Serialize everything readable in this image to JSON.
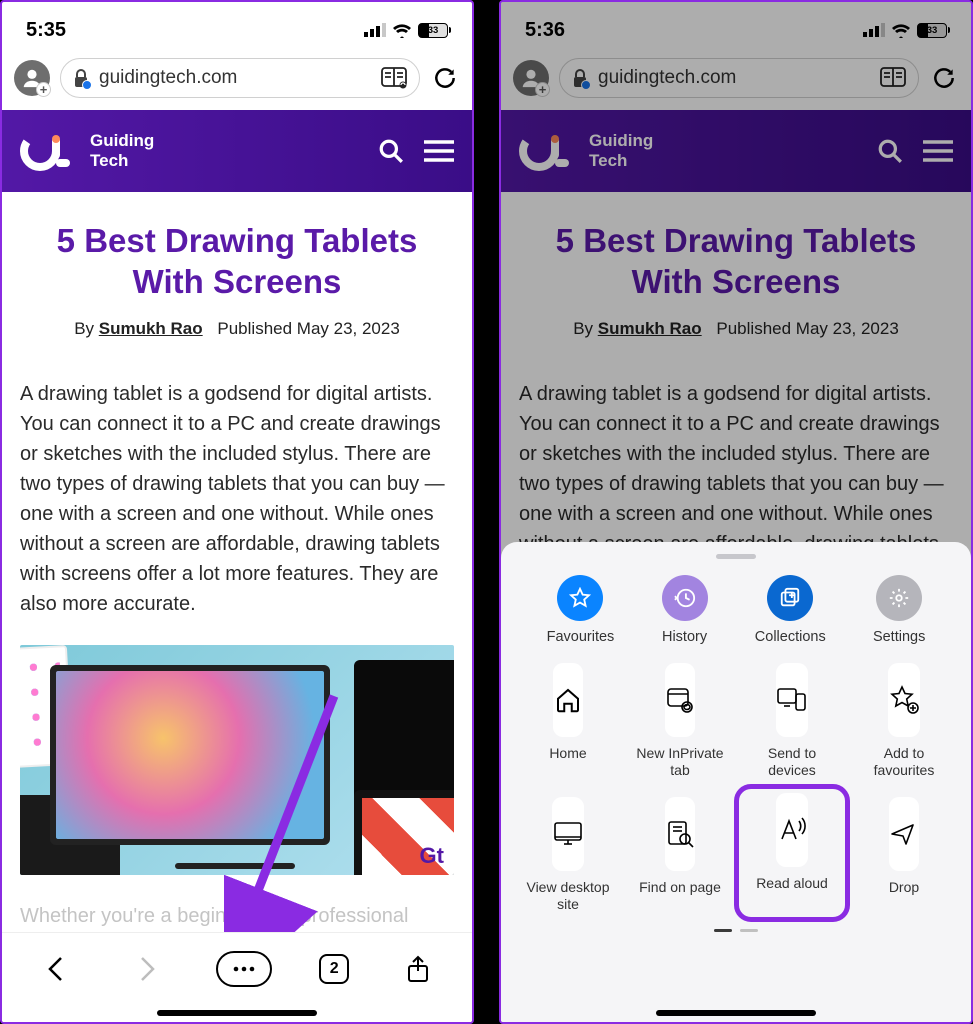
{
  "left": {
    "status": {
      "time": "5:35",
      "battery": "33"
    },
    "browser": {
      "url": "guidingtech.com"
    },
    "site": {
      "name_line1": "Guiding",
      "name_line2": "Tech"
    },
    "article": {
      "title": "5 Best Drawing Tablets With Screens",
      "by_prefix": "By ",
      "author": "Sumukh Rao",
      "published": "Published May 23, 2023",
      "para1": "A drawing tablet is a godsend for digital artists. You can connect it to a PC and create drawings or sketches with the included stylus. There are two types of drawing tablets that you can buy — one with a screen and one without. While ones without a screen are affordable, drawing tablets with screens offer a lot more features. They are also more accurate.",
      "para2": "Whether you're a beginner or a professional looking for a tablet for digital art, consider getting",
      "hero_watermark": "Gt"
    },
    "toolbar": {
      "tab_count": "2"
    }
  },
  "right": {
    "status": {
      "time": "5:36",
      "battery": "33"
    },
    "browser": {
      "url": "guidingtech.com"
    },
    "site": {
      "name_line1": "Guiding",
      "name_line2": "Tech"
    },
    "article": {
      "title": "5 Best Drawing Tablets With Screens",
      "by_prefix": "By ",
      "author": "Sumukh Rao",
      "published": "Published May 23, 2023",
      "para1": "A drawing tablet is a godsend for digital artists. You can connect it to a PC and create drawings or sketches with the included stylus. There are two types of drawing tablets that you can buy — one with a screen and one without. While ones without a screen are affordable, drawing tablets with screens offer a lot more features. They are"
    },
    "sheet": {
      "top": {
        "favourites": "Favourites",
        "history": "History",
        "collections": "Collections",
        "settings": "Settings"
      },
      "tiles": {
        "home": "Home",
        "new_inprivate": "New InPrivate tab",
        "send": "Send to devices",
        "add_fav": "Add to favourites",
        "desktop": "View desktop site",
        "find": "Find on page",
        "read": "Read aloud",
        "drop": "Drop"
      }
    }
  }
}
